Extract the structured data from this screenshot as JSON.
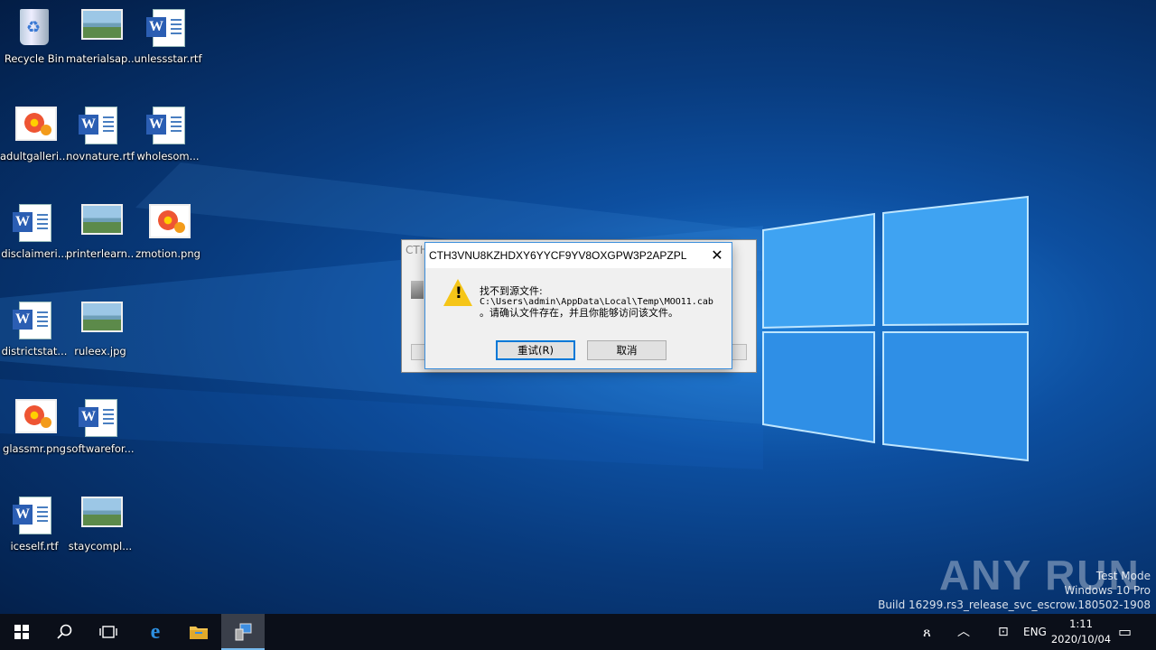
{
  "desktop": {
    "icons": [
      {
        "label": "Recycle Bin",
        "type": "bin"
      },
      {
        "label": "materialsap...",
        "type": "img"
      },
      {
        "label": "unlessstar.rtf",
        "type": "word"
      },
      {
        "label": "adultgalleri...",
        "type": "flower"
      },
      {
        "label": "novnature.rtf",
        "type": "word"
      },
      {
        "label": "wholesom...",
        "type": "word"
      },
      {
        "label": "disclaimeri...",
        "type": "word"
      },
      {
        "label": "printerlearn...",
        "type": "img"
      },
      {
        "label": "zmotion.png",
        "type": "flower"
      },
      {
        "label": "districtstat...",
        "type": "word"
      },
      {
        "label": "ruleex.jpg",
        "type": "img"
      },
      {
        "label": "glassmr.png",
        "type": "flower"
      },
      {
        "label": "softwarefor...",
        "type": "word"
      },
      {
        "label": "iceself.rtf",
        "type": "word"
      },
      {
        "label": "staycompl...",
        "type": "img"
      }
    ]
  },
  "back_window": {
    "title": "CTH"
  },
  "dialog": {
    "title": "CTH3VNU8KZHDXY6YYCF9YV8OXGPW3P2APZPL",
    "line1": "找不到源文件:",
    "line2": "C:\\Users\\admin\\AppData\\Local\\Temp\\MOO11.cab",
    "line3": "。请确认文件存在，并且你能够访问该文件。",
    "retry": "重试(R)",
    "cancel": "取消",
    "close": "✕"
  },
  "watermark": {
    "line1": "Test Mode",
    "line2": "Windows 10 Pro",
    "line3": "Build 16299.rs3_release_svc_escrow.180502-1908",
    "brand": "ANY RUN"
  },
  "taskbar": {
    "lang": "ENG",
    "time": "1:11",
    "date": "2020/10/04"
  }
}
